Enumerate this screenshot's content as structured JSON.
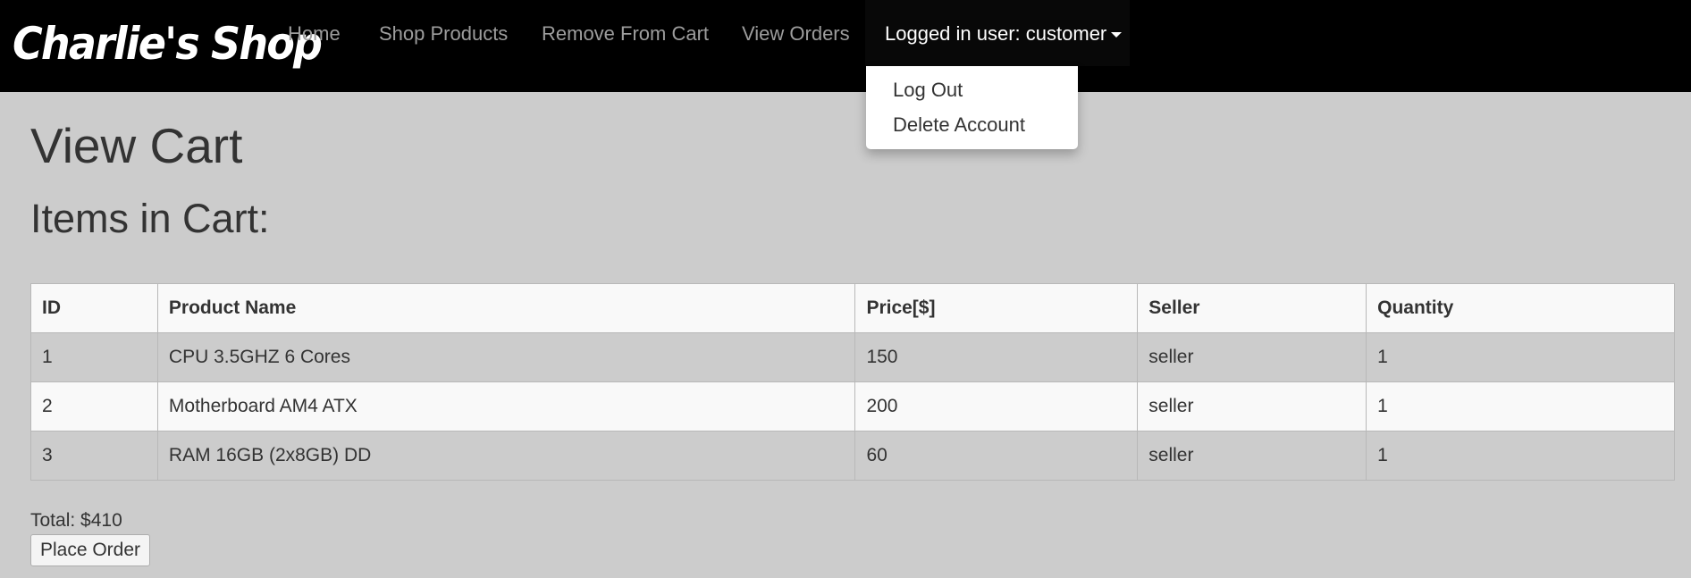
{
  "navbar": {
    "brand": "Charlie's Shop",
    "links": [
      "Home",
      "Shop Products",
      "Remove From Cart",
      "View Orders"
    ],
    "user_menu_label": "Logged in user: customer",
    "dropdown": [
      "Log Out",
      "Delete Account"
    ]
  },
  "page": {
    "title": "View Cart",
    "subtitle": "Items in Cart:"
  },
  "cart_table": {
    "headers": [
      "ID",
      "Product Name",
      "Price[$]",
      "Seller",
      "Quantity"
    ],
    "rows": [
      [
        "1",
        "CPU 3.5GHZ 6 Cores",
        "150",
        "seller",
        "1"
      ],
      [
        "2",
        "Motherboard AM4 ATX",
        "200",
        "seller",
        "1"
      ],
      [
        "3",
        "RAM 16GB (2x8GB) DD",
        "60",
        "seller",
        "1"
      ]
    ]
  },
  "summary": {
    "total": "Total: $410",
    "place_order_label": "Place Order"
  },
  "colors": {
    "navbar_bg": "#000000",
    "page_bg": "#cccccc",
    "table_row_light": "#f9f9f9"
  }
}
